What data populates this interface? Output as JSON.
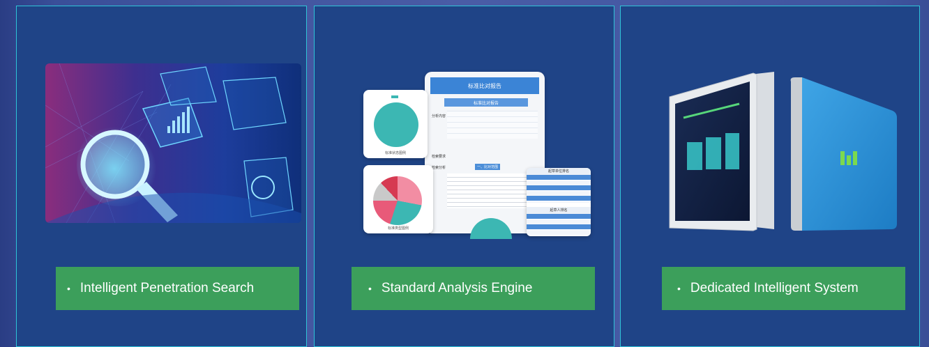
{
  "cards": [
    {
      "label": "Intelligent Penetration Search",
      "bullet": "•",
      "image_icon": "magnifier-data-illustration"
    },
    {
      "label": "Standard Analysis Engine",
      "bullet": "•",
      "image_icon": "tablet-report-mockup"
    },
    {
      "label": "Dedicated Intelligent System",
      "bullet": "•",
      "image_icon": "tablet-device-mockup"
    }
  ],
  "mockup": {
    "header": "标准比对报告",
    "pie_caption_1": "标准状态图例",
    "pie_caption_2": "标准类型图例",
    "tab_title": "标准比对报告",
    "row1": "分析内容",
    "row2": "检索要求",
    "row3": "检索分析",
    "subsection": "一、比对范围",
    "side_title_1": "起草单位排名",
    "side_title_2": "起草人排名"
  },
  "colors": {
    "card_bg": "#1f4487",
    "card_border": "#2ec4d8",
    "label_bg": "#3c9f5b"
  }
}
